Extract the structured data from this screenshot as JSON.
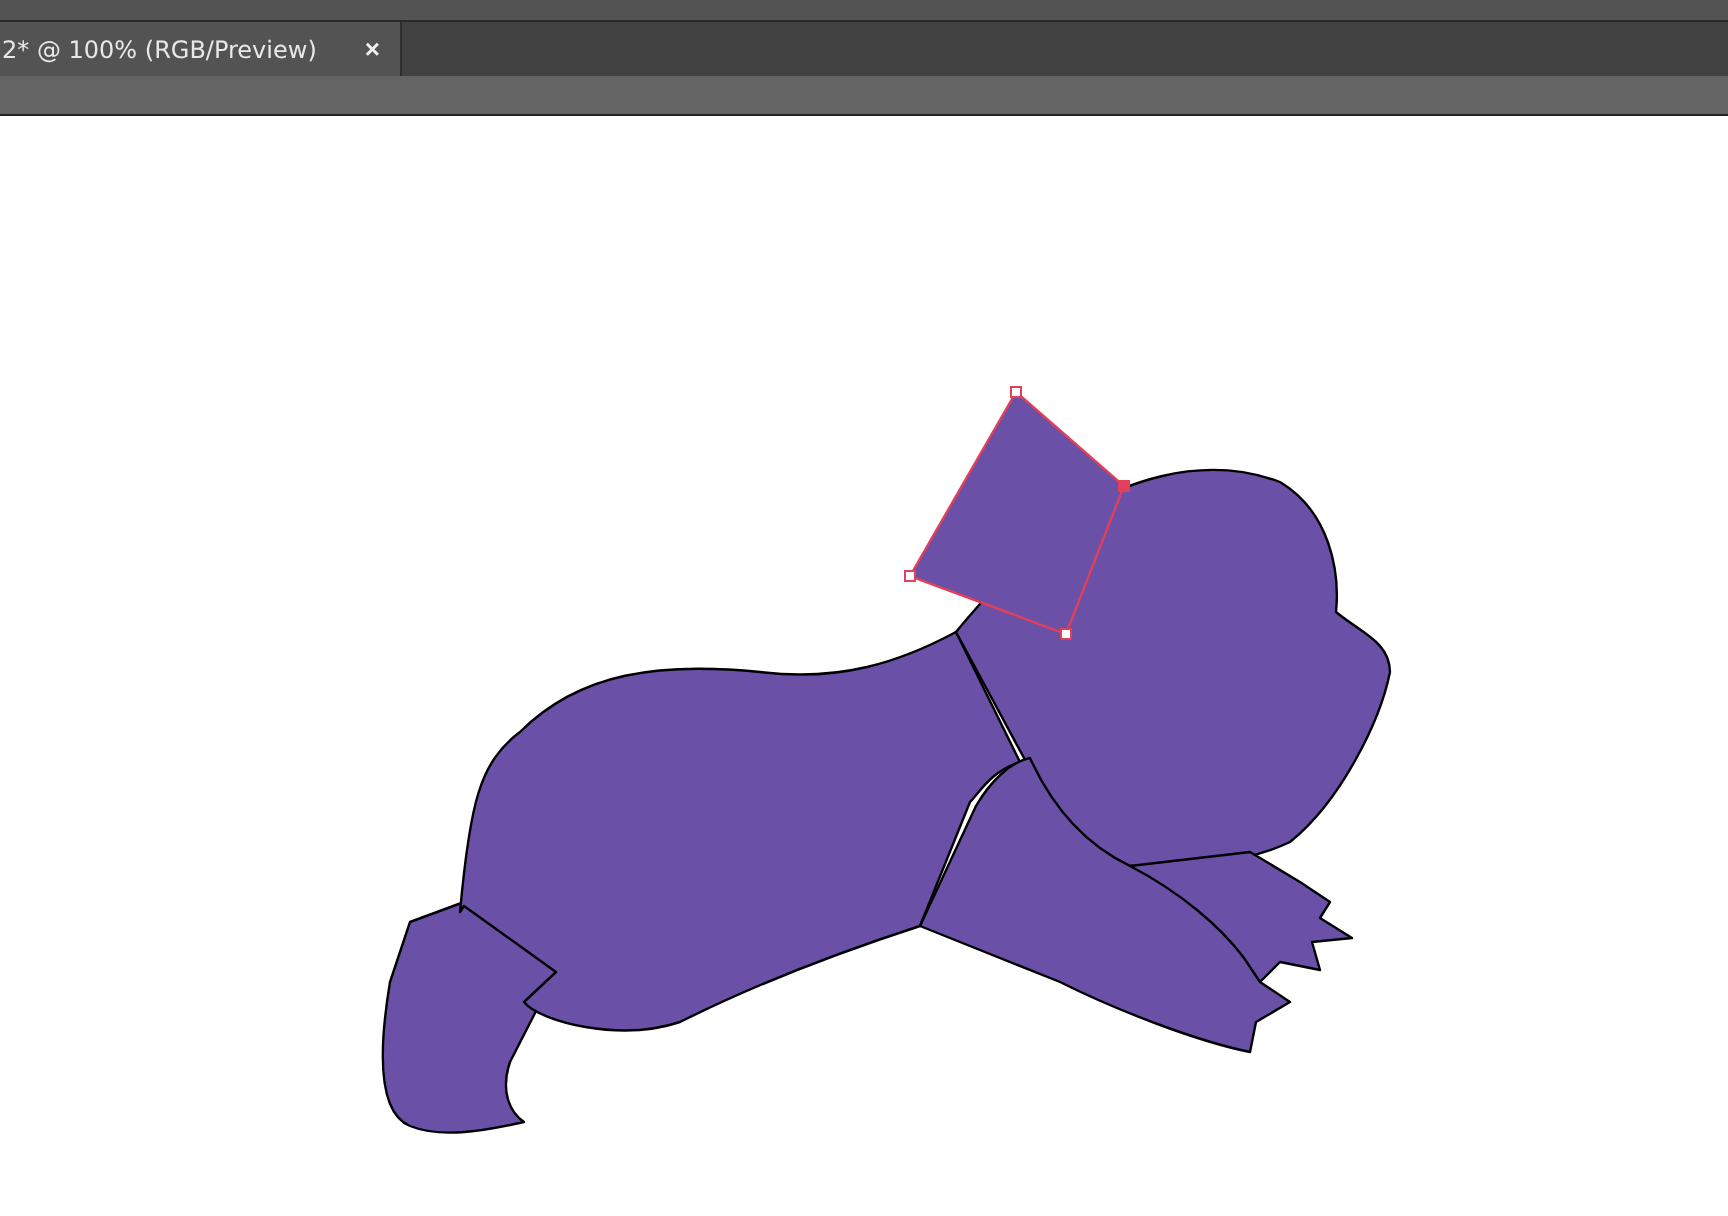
{
  "document_tab": {
    "title": "2* @ 100% (RGB/Preview)",
    "close": "×"
  }
}
